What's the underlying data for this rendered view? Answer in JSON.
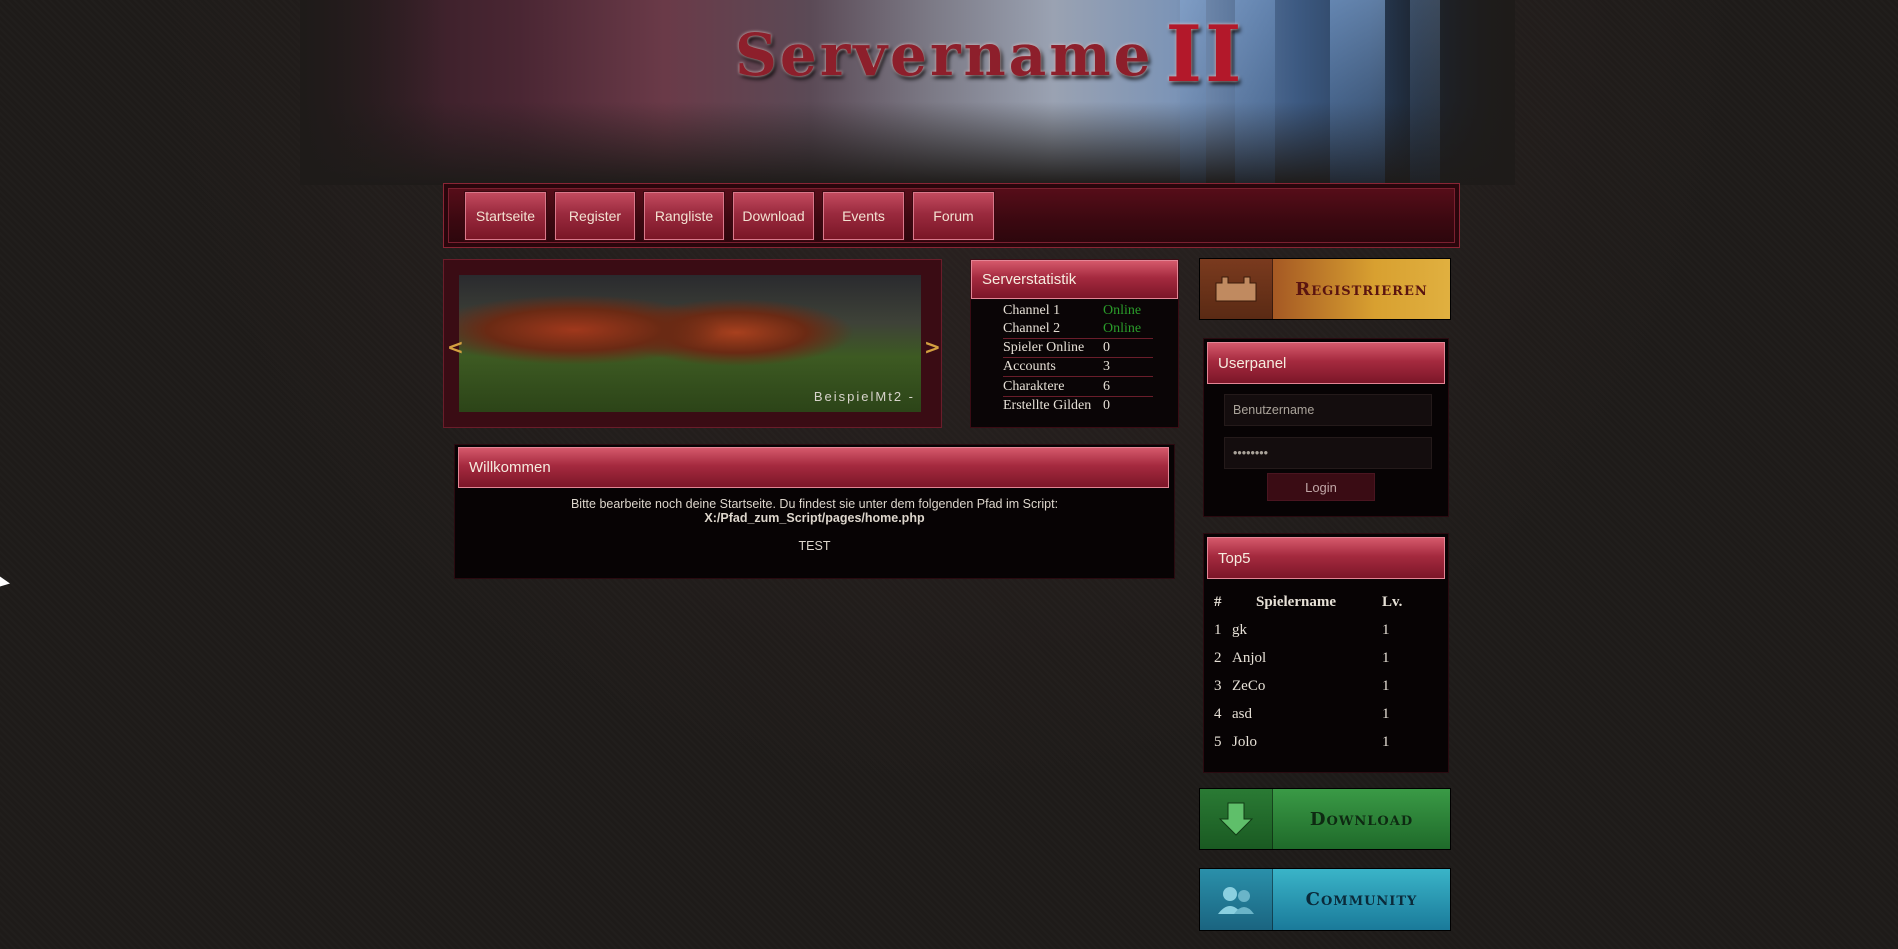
{
  "site": {
    "logo_text": "Servername",
    "logo_suffix": "II"
  },
  "nav": {
    "items": [
      "Startseite",
      "Register",
      "Rangliste",
      "Download",
      "Events",
      "Forum"
    ]
  },
  "slider": {
    "caption": "BeispielMt2 -",
    "prev": "<",
    "next": ">"
  },
  "serverstats": {
    "title": "Serverstatistik",
    "rows": [
      {
        "label": "Channel 1",
        "value": "Online",
        "status": "online"
      },
      {
        "label": "Channel 2",
        "value": "Online",
        "status": "online"
      },
      {
        "label": "Spieler Online",
        "value": "0"
      },
      {
        "label": "Accounts",
        "value": "3"
      },
      {
        "label": "Charaktere",
        "value": "6"
      },
      {
        "label": "Erstellte Gilden",
        "value": "0"
      }
    ]
  },
  "welcome": {
    "title": "Willkommen",
    "line1": "Bitte bearbeite noch deine Startseite. Du findest sie unter dem folgenden Pfad im Script:",
    "path": "X:/Pfad_zum_Script/pages/home.php",
    "note": "TEST"
  },
  "register_banner": {
    "label": "Registrieren"
  },
  "userpanel": {
    "title": "Userpanel",
    "username_placeholder": "Benutzername",
    "password_value": "••••••••",
    "login_label": "Login"
  },
  "top5": {
    "title": "Top5",
    "headers": [
      "#",
      "Spielername",
      "Lv."
    ],
    "rows": [
      {
        "rank": "1",
        "name": "gk",
        "level": "1"
      },
      {
        "rank": "2",
        "name": "Anjol",
        "level": "1"
      },
      {
        "rank": "3",
        "name": "ZeCo",
        "level": "1"
      },
      {
        "rank": "4",
        "name": "asd",
        "level": "1"
      },
      {
        "rank": "5",
        "name": "Jolo",
        "level": "1"
      }
    ]
  },
  "download_banner": {
    "label": "Download"
  },
  "community_banner": {
    "label": "Community"
  },
  "colors": {
    "accent": "#a52a3f",
    "online": "#2a9c2a",
    "download": "#2e8a3a",
    "community": "#2a9aba",
    "register": "#d8a030"
  }
}
